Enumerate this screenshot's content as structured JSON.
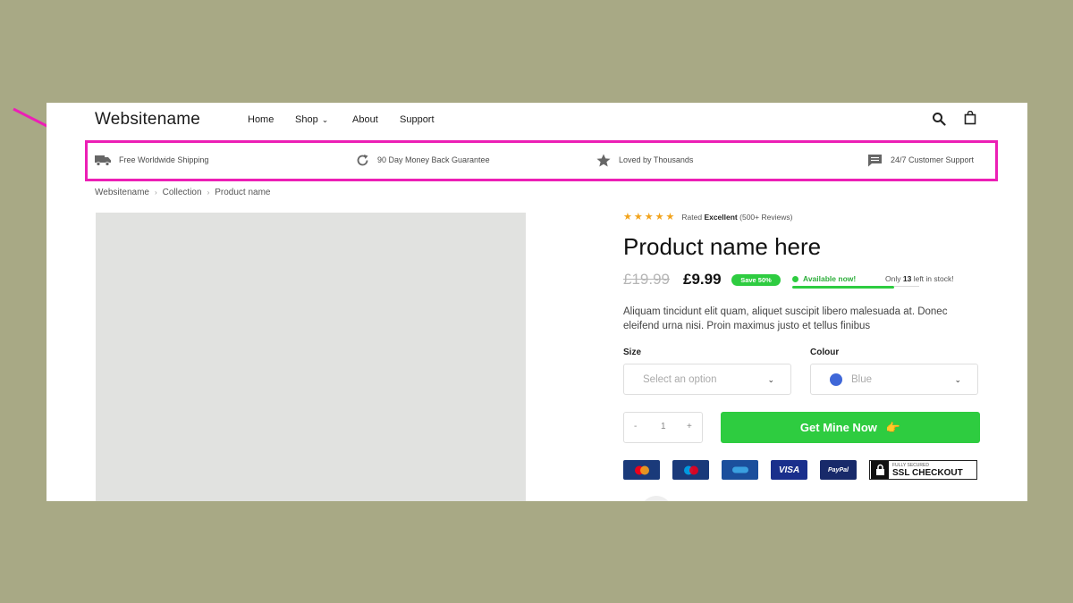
{
  "header": {
    "logo": "Websitename",
    "nav": [
      "Home",
      "Shop",
      "About",
      "Support"
    ],
    "shop_chevron": "⌄"
  },
  "usp_bar": {
    "items": [
      {
        "icon": "truck-icon",
        "text": "Free Worldwide Shipping"
      },
      {
        "icon": "refresh-icon",
        "text": "90 Day Money Back Guarantee"
      },
      {
        "icon": "star-icon",
        "text": "Loved by Thousands"
      },
      {
        "icon": "chat-icon",
        "text": "24/7 Customer Support"
      }
    ]
  },
  "breadcrumb": [
    "Websitename",
    "Collection",
    "Product name"
  ],
  "product": {
    "rating_prefix": "Rated",
    "rating_word": "Excellent",
    "reviews": "(500+ Reviews)",
    "stars": 5,
    "title": "Product name here",
    "old_price": "£19.99",
    "price": "£9.99",
    "save_badge": "Save 50%",
    "availability": "Available now!",
    "stock_prefix": "Only",
    "stock_count": "13",
    "stock_suffix": "left in stock!",
    "stock_fraction": 0.8,
    "description": "Aliquam tincidunt elit quam, aliquet suscipit libero malesuada at. Donec eleifend urna nisi. Proin maximus justo et tellus finibus",
    "size_label": "Size",
    "size_placeholder": "Select an option",
    "colour_label": "Colour",
    "colour_value": "Blue",
    "qty_minus": "-",
    "qty_value": "1",
    "qty_plus": "+",
    "cta": "Get Mine Now",
    "cta_emoji": "👉"
  },
  "payments": {
    "cards": [
      "MasterCard",
      "Maestro",
      "Cirrus",
      "VISA",
      "PayPal"
    ],
    "ssl_small": "FULLY SECURED",
    "ssl_big": "SSL CHECKOUT"
  },
  "colors": {
    "highlight": "#ec1fb5",
    "accent_green": "#2ecc40",
    "star": "#f2a31b",
    "swatch_blue": "#3f67d8"
  }
}
